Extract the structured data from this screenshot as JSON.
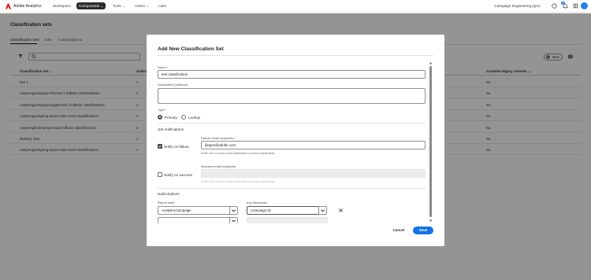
{
  "topnav": {
    "brand": "Adobe Analytics",
    "items": [
      "Workspace",
      "Components",
      "Tools",
      "Admin",
      "Labs"
    ],
    "org": "Campaign Engineering (QA)",
    "notification_count": "8",
    "icons": [
      "help-icon",
      "bell-icon",
      "apps-icon",
      "avatar"
    ]
  },
  "page": {
    "title": "Classification sets",
    "tabs": [
      "Classification sets",
      "Jobs",
      "Consolidations"
    ],
    "new_label": "New",
    "columns": [
      "Classification set",
      "Subsc",
      "Contains legacy rulesets"
    ],
    "rows": [
      {
        "name": "test 1",
        "subs": "1",
        "legacy": "No"
      },
      {
        "name": "campengcampaign-first-test 2 lofbase classifications",
        "subs": "2",
        "legacy": "No"
      },
      {
        "name": "campengcampaign-psgpet-test 3 lofbase classifications",
        "subs": "1",
        "legacy": "No"
      },
      {
        "name": "campengcampeng-report-suite event classifications",
        "subs": "1",
        "legacy": "No"
      },
      {
        "name": "campengkrishnareportsuite lofbase classifications",
        "subs": "3",
        "legacy": "No"
      },
      {
        "name": "Delivery Test",
        "subs": "1",
        "legacy": "No"
      },
      {
        "name": "campengcampeng-report-suite event classifications",
        "subs": "1",
        "legacy": "No"
      }
    ]
  },
  "modal": {
    "title": "Add New Classification Set",
    "name_label": "Name *",
    "name_value": "test classification",
    "description_label": "Description (optional)",
    "type_label": "Type *",
    "type_options": [
      "Primary",
      "Lookup"
    ],
    "type_selected": "Primary",
    "job_notifications_title": "Job notifications",
    "notify_failure_label": "Notify on failure",
    "failure_email_label": "Failure email recipients *",
    "failure_email_value": "jbeges@adobe.com",
    "failure_help": "Enter one or more email addresses (comma separated)",
    "notify_success_label": "Notify on success",
    "success_email_label": "Success email recipients",
    "success_help": "Enter one or more email addresses (comma separated)",
    "subscriptions_title": "Subscriptions",
    "report_suite_label": "Report suite",
    "key_dimension_label": "Key dimension",
    "report_suite_value": "AnalyticsCampaign",
    "key_dimension_value": "Campaign ID",
    "cancel_label": "Cancel",
    "save_label": "Save"
  }
}
